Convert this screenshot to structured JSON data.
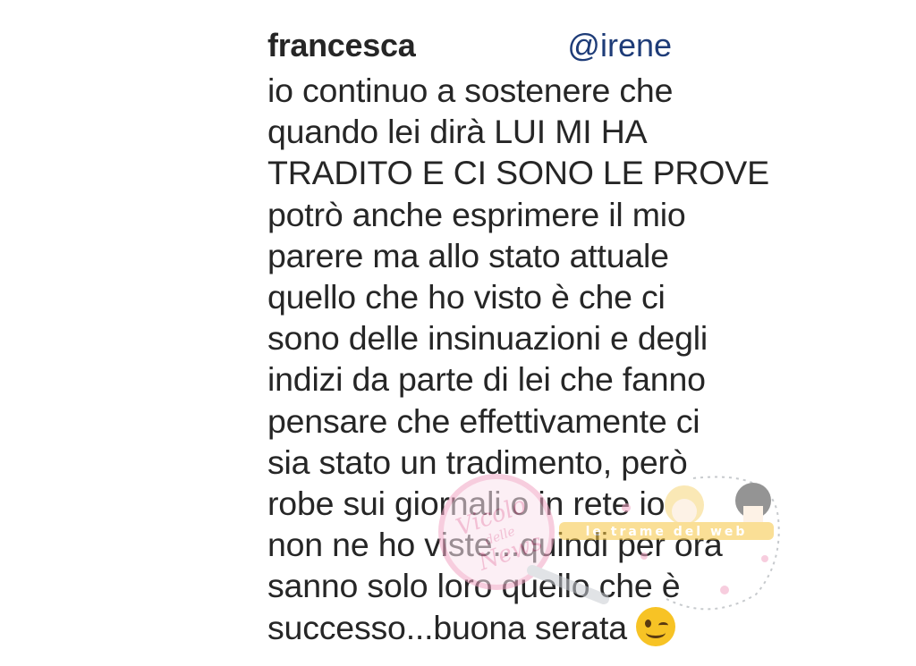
{
  "comment": {
    "username": "francesca",
    "mention": "@irene",
    "lines": [
      "io continuo a sostenere che",
      "quando lei dirà LUI MI HA",
      "TRADITO E CI SONO LE PROVE",
      "potrò anche esprimere il mio",
      "parere ma allo stato attuale",
      "quello che ho visto è che ci",
      "sono delle insinuazioni e degli",
      "indizi da parte di lei che fanno",
      "pensare che effettivamente ci",
      "sia stato un tradimento, però",
      "robe sui giornali o in rete io",
      "non ne ho viste...quindi per ora",
      "sanno solo loro quello che è",
      "successo...buona serata"
    ],
    "emoji": "winking-face-emoji"
  },
  "watermark": {
    "script_text": "Vicolo delle News",
    "banner_text": "le trame del web"
  }
}
